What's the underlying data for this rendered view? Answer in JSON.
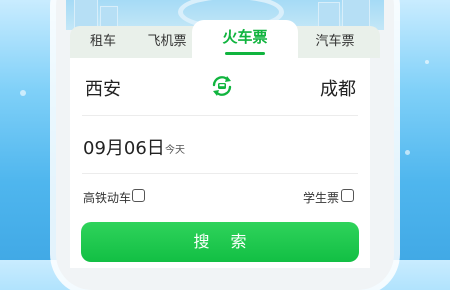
{
  "tabs": [
    {
      "label": "租车",
      "active": false
    },
    {
      "label": "飞机票",
      "active": false
    },
    {
      "label": "火车票",
      "active": true
    },
    {
      "label": "汽车票",
      "active": false
    }
  ],
  "route": {
    "from_city": "西安",
    "to_city": "成都",
    "swap_icon": "swap-train-icon"
  },
  "date": {
    "value": "09月06日",
    "relative": "今天"
  },
  "options": {
    "high_speed_label": "高铁动车",
    "high_speed_checked": false,
    "student_label": "学生票",
    "student_checked": false
  },
  "search_button_label": "搜 索",
  "colors": {
    "accent": "#10b43e",
    "button": "#1fc94f",
    "background": "#4fb6ee"
  }
}
